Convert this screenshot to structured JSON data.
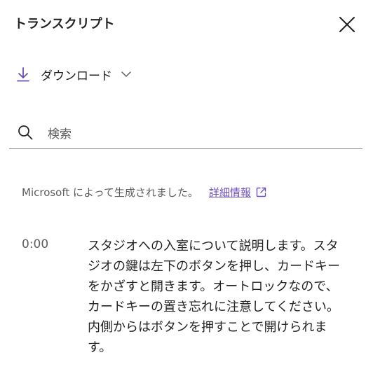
{
  "header": {
    "title": "トランスクリプト",
    "close_icon": "close-icon"
  },
  "download": {
    "label": "ダウンロード",
    "icon": "download-arrow-icon",
    "chevron": "chevron-down-icon"
  },
  "search": {
    "placeholder": "検索",
    "icon": "search-icon"
  },
  "notice": {
    "text": "Microsoft によって生成されました。",
    "link_label": "詳細情報",
    "link_icon": "external-link-icon"
  },
  "transcript": [
    {
      "timestamp": "0:00",
      "text": "スタジオへの入室について説明します。スタジオの鍵は左下のボタンを押し、カードキーをかざすと開きます。オートロックなので、カードキーの置き忘れに注意してください。内側からはボタンを押すことで開けられます。"
    }
  ],
  "colors": {
    "accent": "#6b4fbb",
    "text": "#242424",
    "muted": "#605e5c",
    "divider": "#8a8886"
  }
}
